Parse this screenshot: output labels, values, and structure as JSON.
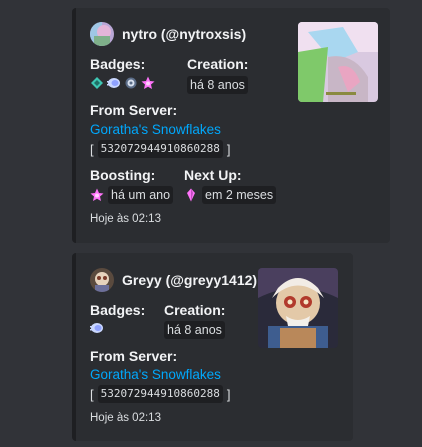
{
  "embeds": [
    {
      "author_name": "nytro (@nytroxsis)",
      "badges_title": "Badges:",
      "badges": [
        "hypesquad-balance-icon",
        "nitro-icon",
        "quest-icon",
        "server-boost-icon"
      ],
      "creation_title": "Creation:",
      "creation_value": "há 8 anos",
      "server_title": "From Server:",
      "server_name": "Goratha's Snowflakes",
      "server_id_open": "[",
      "server_id": "532072944910860288",
      "server_id_close": "]",
      "boosting_title": "Boosting:",
      "boosting_value": "há um ano",
      "nextup_title": "Next Up:",
      "nextup_value": "em 2 meses",
      "footer": "Hoje às 02:13"
    },
    {
      "author_name": "Greyy (@greyy1412)",
      "badges_title": "Badges:",
      "badges": [
        "nitro-icon"
      ],
      "creation_title": "Creation:",
      "creation_value": "há 8 anos",
      "server_title": "From Server:",
      "server_name": "Goratha's Snowflakes",
      "server_id_open": "[",
      "server_id": "532072944910860288",
      "server_id_close": "]",
      "footer": "Hoje às 02:13"
    }
  ],
  "colors": {
    "background": "#313338",
    "embed_background": "#2b2d31",
    "link": "#00a8fc",
    "code_background": "#1e1f22"
  }
}
